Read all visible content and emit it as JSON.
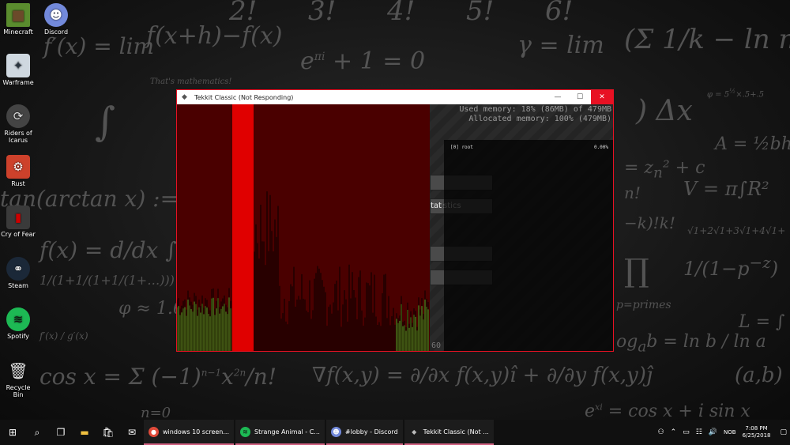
{
  "desktop": {
    "icons": [
      {
        "label": "Minecraft",
        "icon": "minecraft-icon",
        "color": "#5a8c2e"
      },
      {
        "label": "Discord",
        "icon": "discord-icon",
        "color": "#7289da"
      },
      {
        "label": "Warframe",
        "icon": "warframe-icon",
        "color": "#cfd8e0"
      },
      {
        "label": "Riders of Icarus",
        "icon": "riders-icon",
        "color": "#444444"
      },
      {
        "label": "Rust",
        "icon": "rust-icon",
        "color": "#cd412b"
      },
      {
        "label": "Cry of Fear",
        "icon": "cry-of-fear-icon",
        "color": "#3a3a3a"
      },
      {
        "label": "Steam",
        "icon": "steam-icon",
        "color": "#1b2838"
      },
      {
        "label": "Spotify",
        "icon": "spotify-icon",
        "color": "#1db954"
      },
      {
        "label": "Recycle Bin",
        "icon": "recycle-bin-icon",
        "color": "#dddddd"
      }
    ]
  },
  "window": {
    "title": "Tekkit Classic (Not Responding)",
    "minimize_glyph": "—",
    "maximize_glyph": "☐",
    "close_glyph": "✕",
    "memory_used": "Used memory: 18% (86MB) of 479MB",
    "memory_allocated": "Allocated memory: 100% (479MB)",
    "profiler_root": "[0] root",
    "profiler_root_pct": "0.00%",
    "button_stats_partial": "tat",
    "button_stats_text": "stics",
    "fps_partial": "60",
    "accent_color": "#e81123"
  },
  "taskbar": {
    "tasks": [
      {
        "label": "windows 10 screen...",
        "icon": "chrome-icon",
        "color": "#e04a3a"
      },
      {
        "label": "Strange Animal - C...",
        "icon": "spotify-icon",
        "color": "#1db954"
      },
      {
        "label": "#lobby - Discord",
        "icon": "discord-icon",
        "color": "#7289da"
      },
      {
        "label": "Tekkit Classic (Not ...",
        "icon": "tekkit-icon",
        "color": "#999999"
      }
    ],
    "language": "NOB",
    "time": "7:08 PM",
    "date": "6/25/2018"
  }
}
